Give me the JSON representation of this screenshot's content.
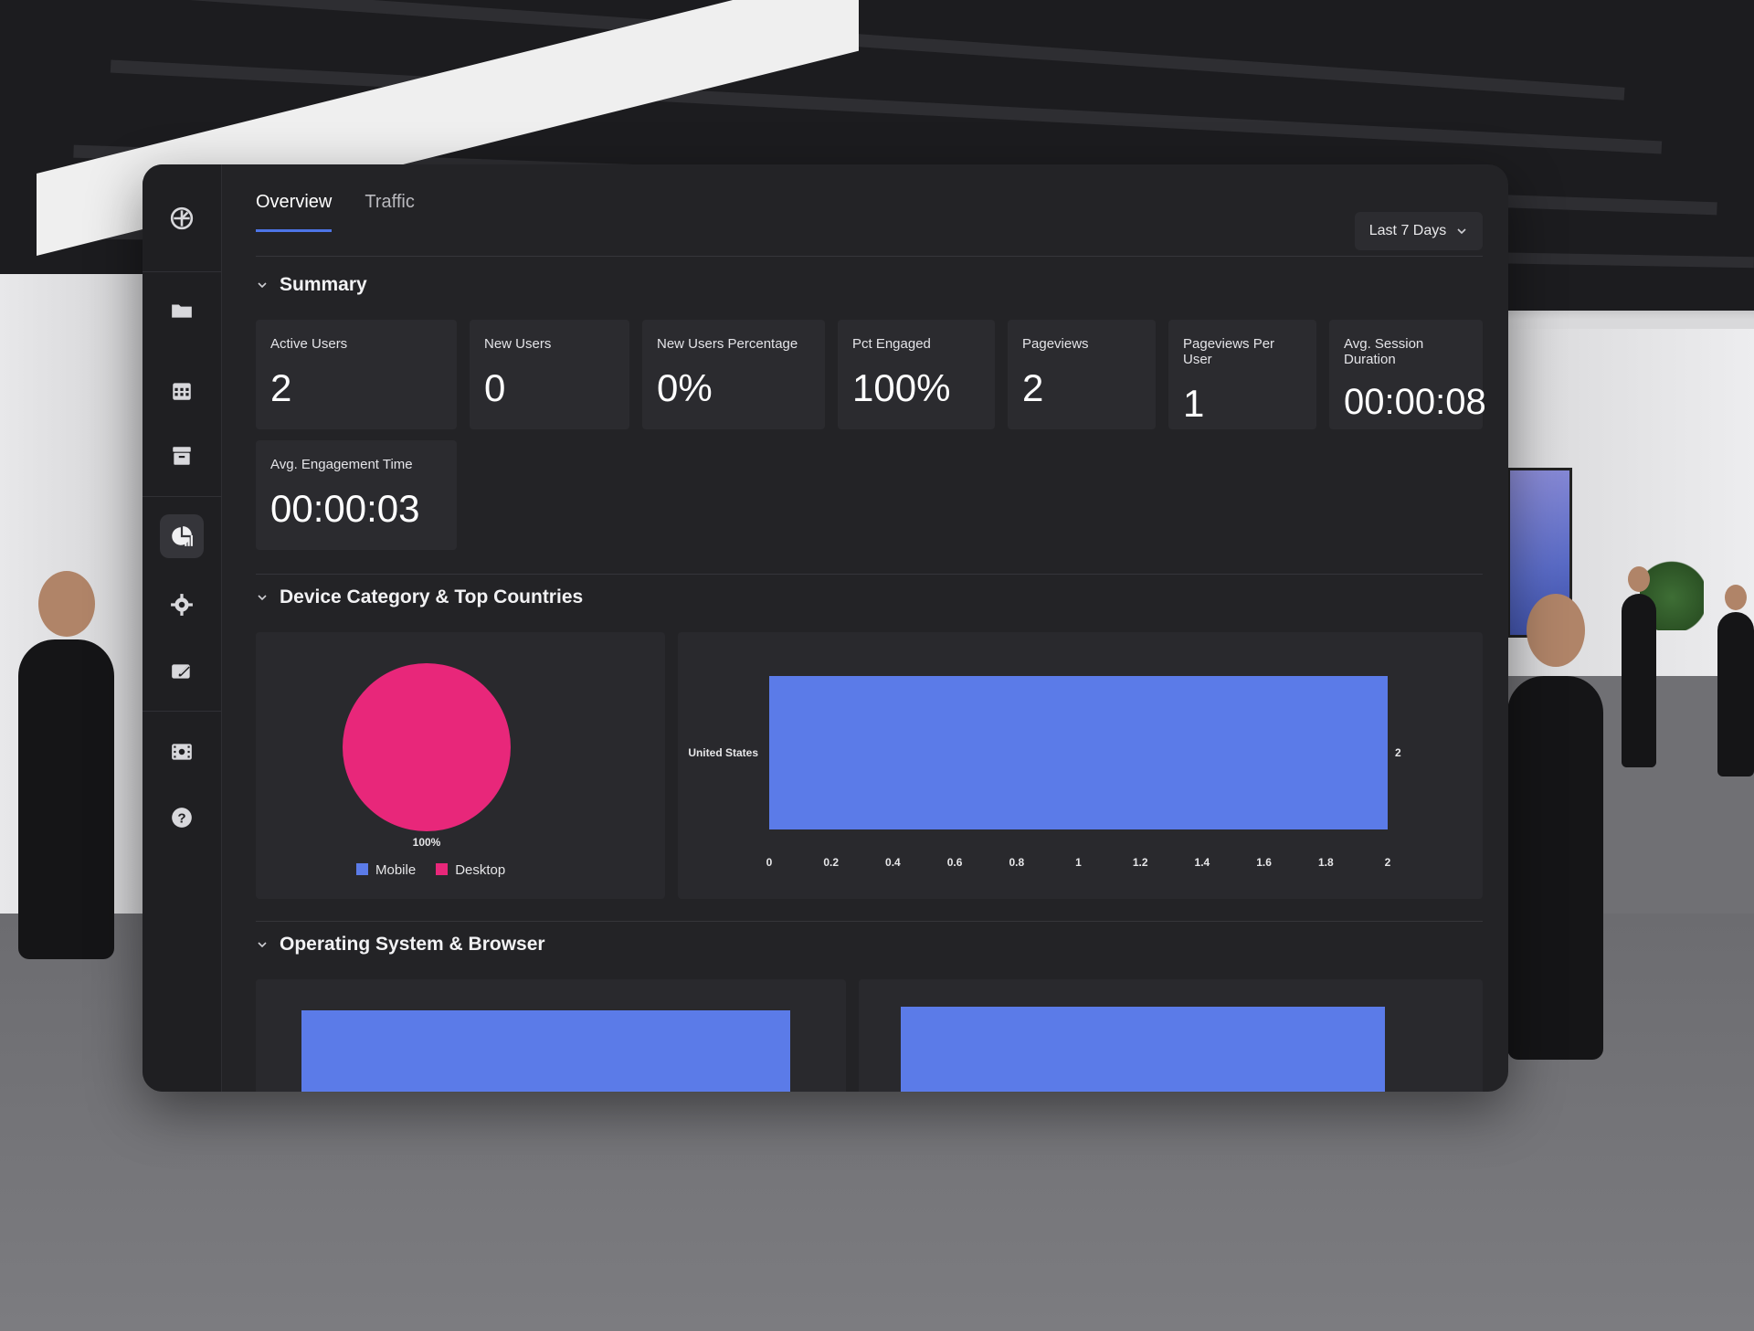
{
  "app": {
    "tabs": [
      {
        "label": "Overview",
        "active": true
      },
      {
        "label": "Traffic",
        "active": false
      }
    ],
    "date_range": "Last 7 Days"
  },
  "sidebar": {
    "items": [
      {
        "name": "logo",
        "icon": "logo-icon"
      },
      {
        "name": "folder",
        "icon": "folder-icon"
      },
      {
        "name": "calendar",
        "icon": "calendar-icon"
      },
      {
        "name": "archive",
        "icon": "archive-icon"
      },
      {
        "name": "analytics",
        "icon": "analytics-icon",
        "active": true
      },
      {
        "name": "settings",
        "icon": "gear-icon"
      },
      {
        "name": "edit",
        "icon": "edit-card-icon"
      },
      {
        "name": "media",
        "icon": "film-icon"
      },
      {
        "name": "help",
        "icon": "help-icon"
      }
    ]
  },
  "summary": {
    "title": "Summary",
    "metrics": [
      {
        "label": "Active Users",
        "value": "2"
      },
      {
        "label": "New Users",
        "value": "0"
      },
      {
        "label": "New Users Percentage",
        "value": "0%"
      },
      {
        "label": "Pct Engaged",
        "value": "100%"
      },
      {
        "label": "Pageviews",
        "value": "2"
      },
      {
        "label": "Pageviews Per User",
        "value": "1"
      },
      {
        "label": "Avg. Session Duration",
        "value": "00:00:08"
      },
      {
        "label": "Avg. Engagement Time",
        "value": "00:00:03"
      }
    ]
  },
  "device_section": {
    "title": "Device Category & Top Countries"
  },
  "os_section": {
    "title": "Operating System & Browser"
  },
  "colors": {
    "mobile": "#5b7be8",
    "desktop": "#e8277a",
    "bar": "#5b7be8",
    "accent": "#4d74e6"
  },
  "chart_data": [
    {
      "type": "pie",
      "categories": [
        "Mobile",
        "Desktop"
      ],
      "values": [
        0,
        100
      ],
      "data_labels": [
        "100%"
      ],
      "legend": [
        "Mobile",
        "Desktop"
      ],
      "legend_placement": "bottom"
    },
    {
      "type": "bar",
      "orientation": "horizontal",
      "categories": [
        "United States"
      ],
      "values": [
        2
      ],
      "data_labels": [
        "2"
      ],
      "xlim": [
        0,
        2
      ],
      "xticks": [
        "0",
        "0.2",
        "0.4",
        "0.6",
        "0.8",
        "1",
        "1.2",
        "1.4",
        "1.6",
        "1.8",
        "2"
      ],
      "grid": false
    }
  ]
}
